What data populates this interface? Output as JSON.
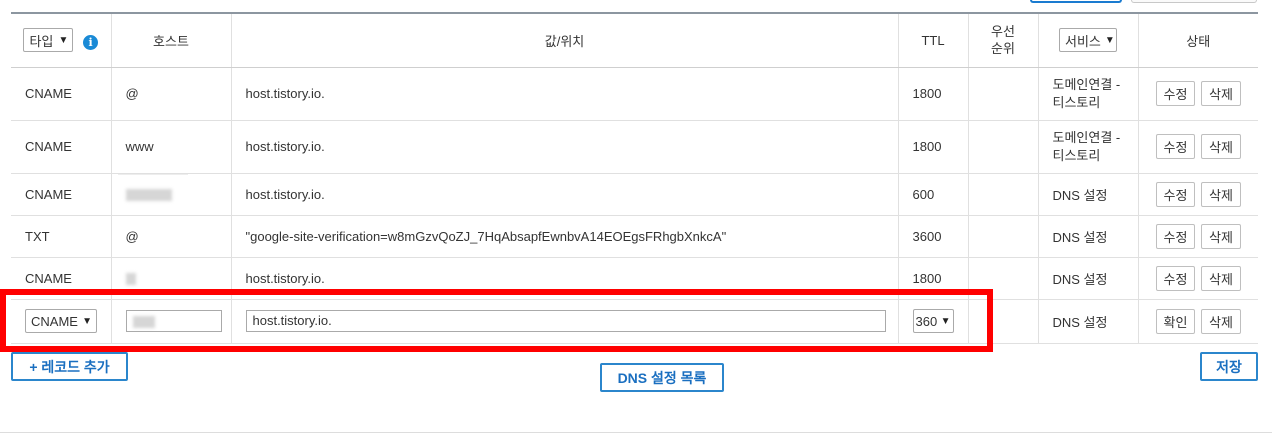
{
  "header": {
    "type_select": "타입",
    "host": "호스트",
    "value": "값/위치",
    "ttl": "TTL",
    "priority_line1": "우선",
    "priority_line2": "순위",
    "service_select": "서비스",
    "status": "상태"
  },
  "rows": [
    {
      "type": "CNAME",
      "host": "@",
      "value": "host.tistory.io.",
      "ttl": "1800",
      "service_line1": "도메인연결 -",
      "service_line2": "티스토리",
      "edit": "수정",
      "delete": "삭제"
    },
    {
      "type": "CNAME",
      "host": "www",
      "value": "host.tistory.io.",
      "ttl": "1800",
      "service_line1": "도메인연결 -",
      "service_line2": "티스토리",
      "edit": "수정",
      "delete": "삭제"
    },
    {
      "type": "CNAME",
      "host": "",
      "value": "host.tistory.io.",
      "ttl": "600",
      "service": "DNS 설정",
      "edit": "수정",
      "delete": "삭제"
    },
    {
      "type": "TXT",
      "host": "@",
      "value": "\"google-site-verification=w8mGzvQoZJ_7HqAbsapfEwnbvA14EOEgsFRhgbXnkcA\"",
      "ttl": "3600",
      "service": "DNS 설정",
      "edit": "수정",
      "delete": "삭제"
    },
    {
      "type": "CNAME",
      "host": "",
      "value": "host.tistory.io.",
      "ttl": "1800",
      "service": "DNS 설정",
      "edit": "수정",
      "delete": "삭제"
    }
  ],
  "edit_row": {
    "type": "CNAME",
    "host": "",
    "value": "host.tistory.io.",
    "ttl": "360",
    "service": "DNS 설정",
    "confirm": "확인",
    "delete": "삭제"
  },
  "actions": {
    "add_record": "+ 레코드 추가",
    "dns_list": "DNS 설정 목록",
    "save": "저장"
  },
  "colors": {
    "accent": "#2b86cc",
    "highlight": "#ff0000",
    "info": "#1a8ad6"
  }
}
